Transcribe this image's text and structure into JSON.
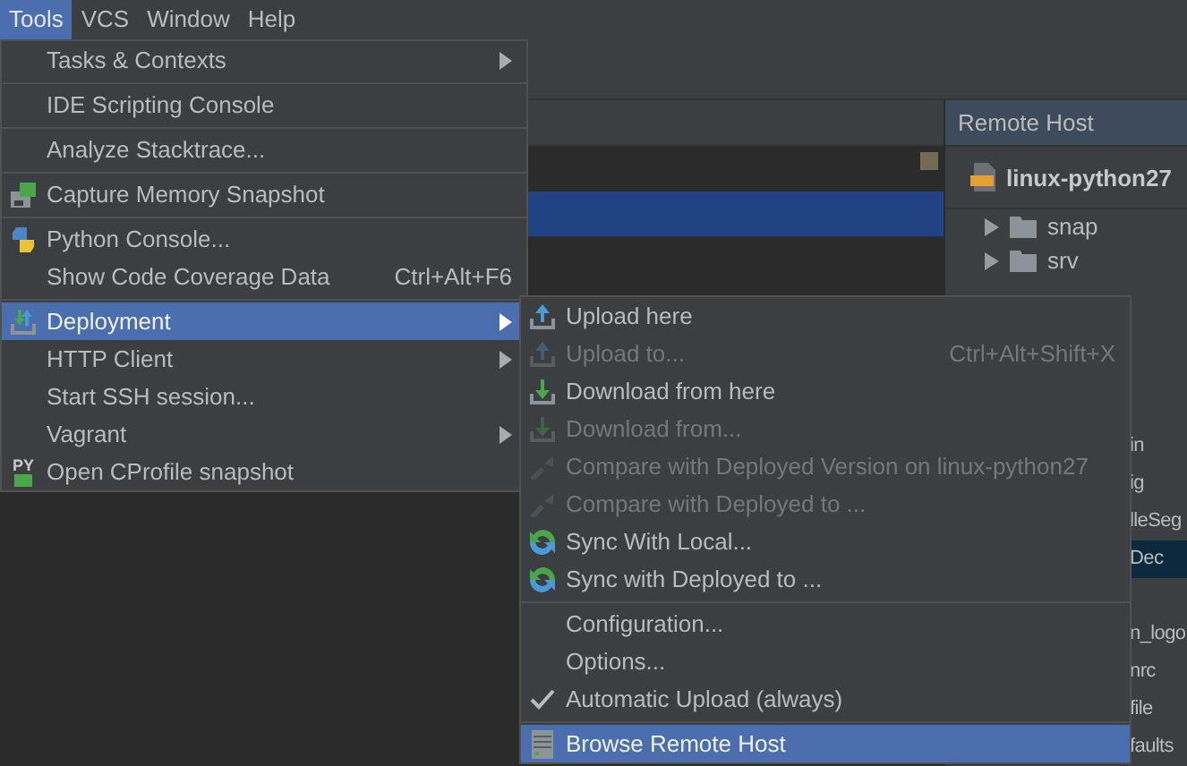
{
  "menubar": [
    {
      "label": "Tools",
      "selected": true
    },
    {
      "label": "VCS",
      "selected": false
    },
    {
      "label": "Window",
      "selected": false
    },
    {
      "label": "Help",
      "selected": false
    }
  ],
  "remote_host": {
    "title": "Remote Host",
    "server": "linux-python27",
    "tree": [
      {
        "label": "snap",
        "expanded": false
      },
      {
        "label": "srv",
        "expanded": false
      }
    ],
    "partial_rows": [
      {
        "text": "in",
        "selected": false
      },
      {
        "text": "ig",
        "selected": false
      },
      {
        "text": "lleSeg",
        "selected": false
      },
      {
        "text": "Dec",
        "selected": true
      }
    ],
    "partial_rows_below": [
      {
        "text": "n_logo",
        "selected": false
      },
      {
        "text": "nrc",
        "selected": false
      },
      {
        "text": "file",
        "selected": false
      },
      {
        "text": "faults",
        "selected": false
      }
    ]
  },
  "tools_menu": [
    {
      "kind": "item",
      "label": "Tasks & Contexts",
      "submenu": true,
      "selected": false,
      "disabled": false
    },
    {
      "kind": "separator"
    },
    {
      "kind": "item",
      "label": "IDE Scripting Console",
      "submenu": false,
      "selected": false,
      "disabled": false
    },
    {
      "kind": "separator"
    },
    {
      "kind": "item",
      "label": "Analyze Stacktrace...",
      "submenu": false,
      "selected": false,
      "disabled": false
    },
    {
      "kind": "separator"
    },
    {
      "kind": "memory",
      "label": "Capture Memory Snapshot",
      "submenu": false,
      "selected": false,
      "disabled": false
    },
    {
      "kind": "separator"
    },
    {
      "kind": "python",
      "label": "Python Console...",
      "submenu": false,
      "selected": false,
      "disabled": false
    },
    {
      "kind": "item",
      "label": "Show Code Coverage Data",
      "shortcut": "Ctrl+Alt+F6",
      "submenu": false,
      "selected": false,
      "disabled": false
    },
    {
      "kind": "separator"
    },
    {
      "kind": "deploy",
      "label": "Deployment",
      "submenu": true,
      "selected": true,
      "disabled": false
    },
    {
      "kind": "item",
      "label": "HTTP Client",
      "submenu": true,
      "selected": false,
      "disabled": false
    },
    {
      "kind": "item",
      "label": "Start SSH session...",
      "submenu": false,
      "selected": false,
      "disabled": false
    },
    {
      "kind": "item",
      "label": "Vagrant",
      "submenu": true,
      "selected": false,
      "disabled": false
    },
    {
      "kind": "profile",
      "label": "Open CProfile snapshot",
      "icon_text": "PY",
      "submenu": false,
      "selected": false,
      "disabled": false
    }
  ],
  "deployment_menu": [
    {
      "kind": "upload",
      "label": "Upload here",
      "selected": false,
      "disabled": false,
      "checked": false
    },
    {
      "kind": "upload",
      "label": "Upload to...",
      "shortcut": "Ctrl+Alt+Shift+X",
      "selected": false,
      "disabled": true,
      "checked": false
    },
    {
      "kind": "download",
      "label": "Download from here",
      "selected": false,
      "disabled": false,
      "checked": false
    },
    {
      "kind": "download",
      "label": "Download from...",
      "selected": false,
      "disabled": true,
      "checked": false
    },
    {
      "kind": "compare",
      "label": "Compare with Deployed Version on linux-python27",
      "selected": false,
      "disabled": true,
      "checked": false
    },
    {
      "kind": "compare",
      "label": "Compare with Deployed to ...",
      "selected": false,
      "disabled": true,
      "checked": false
    },
    {
      "kind": "sync",
      "label": "Sync With Local...",
      "selected": false,
      "disabled": false,
      "checked": false
    },
    {
      "kind": "sync",
      "label": "Sync with Deployed to ...",
      "selected": false,
      "disabled": false,
      "checked": false
    },
    {
      "kind": "separator"
    },
    {
      "kind": "item",
      "label": "Configuration...",
      "selected": false,
      "disabled": false,
      "checked": false
    },
    {
      "kind": "item",
      "label": "Options...",
      "selected": false,
      "disabled": false,
      "checked": false
    },
    {
      "kind": "item",
      "label": "Automatic Upload (always)",
      "selected": false,
      "disabled": false,
      "checked": true
    },
    {
      "kind": "separator"
    },
    {
      "kind": "server",
      "label": "Browse Remote Host",
      "selected": true,
      "disabled": false,
      "checked": false
    }
  ]
}
